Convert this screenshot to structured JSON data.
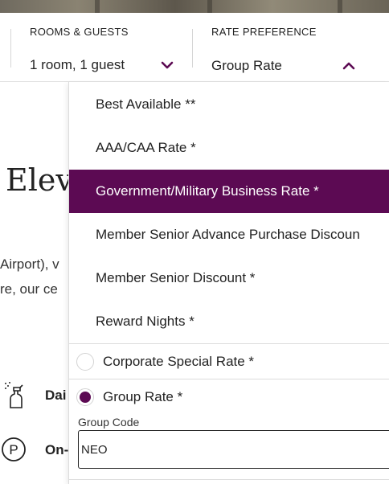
{
  "booking_bar": {
    "rooms_label": "ROOMS & GUESTS",
    "rooms_value": "1 room, 1 guest",
    "rate_label": "RATE PREFERENCE",
    "rate_value": "Group Rate"
  },
  "background": {
    "title": "Elev",
    "line1": "Airport), v",
    "line2": "re, our ce",
    "amenity1": "Dai",
    "amenity2": "On-"
  },
  "rate_options": [
    {
      "label": "Best Available **",
      "selected": false
    },
    {
      "label": "AAA/CAA Rate *",
      "selected": false
    },
    {
      "label": "Government/Military Business Rate *",
      "selected": true
    },
    {
      "label": "Member Senior Advance Purchase Discoun",
      "selected": false
    },
    {
      "label": "Member Senior Discount *",
      "selected": false
    },
    {
      "label": "Reward Nights *",
      "selected": false
    }
  ],
  "radio_options": [
    {
      "label": "Corporate Special Rate *",
      "checked": false
    },
    {
      "label": "Group Rate *",
      "checked": true
    }
  ],
  "group_code": {
    "label": "Group Code",
    "value": "NEO"
  },
  "colors": {
    "brand": "#5c0a53"
  }
}
